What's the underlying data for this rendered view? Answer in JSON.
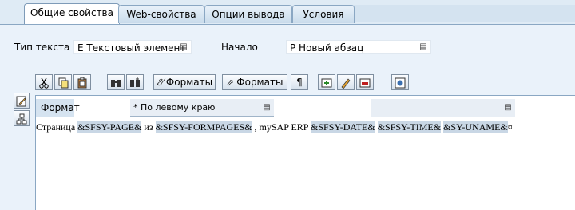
{
  "tabs": [
    {
      "label": "Общие свойства",
      "active": true
    },
    {
      "label": "Web-свойства",
      "active": false
    },
    {
      "label": "Опции вывода",
      "active": false
    },
    {
      "label": "Условия",
      "active": false
    }
  ],
  "text_type": {
    "label": "Тип текста",
    "value": "E Текстовый элемент"
  },
  "start": {
    "label": "Начало",
    "value": "P Новый абзац"
  },
  "toolbar": {
    "formats_char_label": "Форматы",
    "formats_para_label": "Форматы",
    "paragraph_mark": "¶"
  },
  "editor": {
    "format_label": "Формат",
    "paragraph_format_value": "* По левому краю",
    "text_segments": [
      {
        "text": "Страница ",
        "symbol": false
      },
      {
        "text": "&SFSY-PAGE&",
        "symbol": true
      },
      {
        "text": " из ",
        "symbol": false
      },
      {
        "text": "&SFSY-FORMPAGES&",
        "symbol": true
      },
      {
        "text": " , mySAP ERP ",
        "symbol": false
      },
      {
        "text": "&SFSY-DATE&",
        "symbol": true
      },
      {
        "text": " ",
        "symbol": false
      },
      {
        "text": "&SFSY-TIME&",
        "symbol": true
      },
      {
        "text": " ",
        "symbol": false
      },
      {
        "text": "&SY-UNAME&",
        "symbol": true
      },
      {
        "text": "¤",
        "symbol": false
      }
    ]
  },
  "colors": {
    "background": "#dfebf5",
    "panel": "#eaf2fa",
    "symbol_highlight": "#c9d7e5"
  }
}
